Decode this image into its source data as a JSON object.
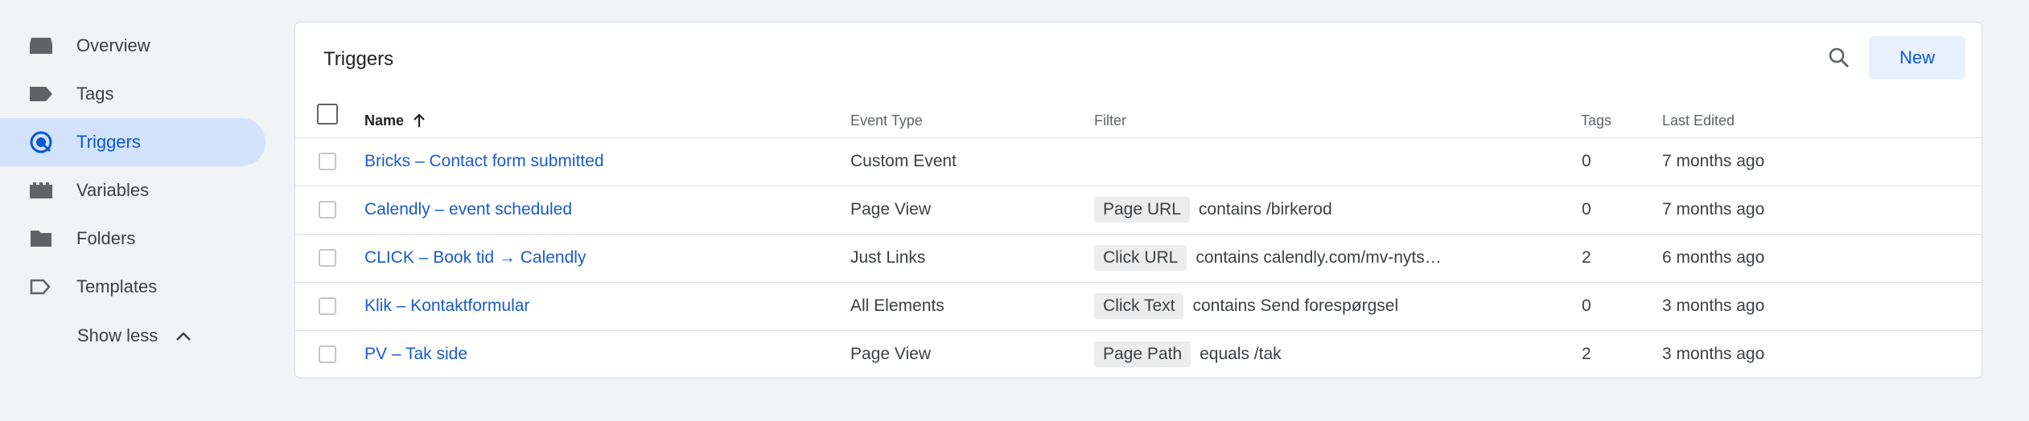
{
  "sidebar": {
    "items": [
      {
        "label": "Overview",
        "icon": "overview-icon"
      },
      {
        "label": "Tags",
        "icon": "tag-icon"
      },
      {
        "label": "Triggers",
        "icon": "trigger-icon",
        "active": true
      },
      {
        "label": "Variables",
        "icon": "variables-icon"
      },
      {
        "label": "Folders",
        "icon": "folder-icon"
      },
      {
        "label": "Templates",
        "icon": "template-icon"
      }
    ],
    "show_less_label": "Show less"
  },
  "card": {
    "title": "Triggers",
    "new_label": "New"
  },
  "table": {
    "columns": {
      "name": "Name",
      "event_type": "Event Type",
      "filter": "Filter",
      "tags": "Tags",
      "last_edited": "Last Edited"
    },
    "rows": [
      {
        "name": "Bricks – Contact form submitted",
        "event_type": "Custom Event",
        "filter_chip": "",
        "filter_text": "",
        "tags": "0",
        "last_edited": "7 months ago"
      },
      {
        "name": "Calendly – event scheduled",
        "event_type": "Page View",
        "filter_chip": "Page URL",
        "filter_text": "contains /birkerod",
        "tags": "0",
        "last_edited": "7 months ago"
      },
      {
        "name": "CLICK – Book tid → Calendly",
        "event_type": "Just Links",
        "filter_chip": "Click URL",
        "filter_text": "contains calendly.com/mv-nyts…",
        "tags": "2",
        "last_edited": "6 months ago"
      },
      {
        "name": "Klik – Kontaktformular",
        "event_type": "All Elements",
        "filter_chip": "Click Text",
        "filter_text": "contains Send forespørgsel",
        "tags": "0",
        "last_edited": "3 months ago"
      },
      {
        "name": "PV – Tak side",
        "event_type": "Page View",
        "filter_chip": "Page Path",
        "filter_text": "equals /tak",
        "tags": "2",
        "last_edited": "3 months ago"
      }
    ]
  },
  "colors": {
    "accent": "#0b57d0",
    "link": "#1a5cc6",
    "active_nav_bg": "#d3e3fd",
    "page_bg": "#f1f3f4"
  }
}
